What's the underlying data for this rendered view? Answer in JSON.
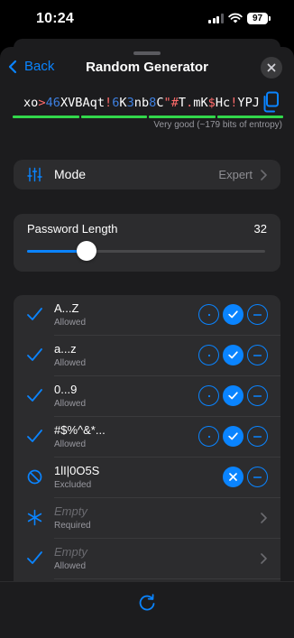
{
  "status": {
    "time": "10:24",
    "battery": "97"
  },
  "nav": {
    "back_label": "Back",
    "title": "Random Generator"
  },
  "password": {
    "parts": [
      {
        "t": "xo",
        "k": "l"
      },
      {
        "t": ">",
        "k": "s"
      },
      {
        "t": "46",
        "k": "d"
      },
      {
        "t": "XVBAqt",
        "k": "l"
      },
      {
        "t": "!",
        "k": "s"
      },
      {
        "t": "6",
        "k": "d"
      },
      {
        "t": "K",
        "k": "l"
      },
      {
        "t": "3",
        "k": "d"
      },
      {
        "t": "nb",
        "k": "l"
      },
      {
        "t": "8",
        "k": "d"
      },
      {
        "t": "C",
        "k": "l"
      },
      {
        "t": "\"#",
        "k": "s"
      },
      {
        "t": "T",
        "k": "l"
      },
      {
        "t": ".",
        "k": "s"
      },
      {
        "t": "mK",
        "k": "l"
      },
      {
        "t": "$",
        "k": "s"
      },
      {
        "t": "Hc",
        "k": "l"
      },
      {
        "t": "!",
        "k": "s"
      },
      {
        "t": "YPJ",
        "k": "l"
      }
    ],
    "strength_text": "Very good (~179 bits of entropy)",
    "strength_color": "#32d74b",
    "digit_color": "#3d7fe0",
    "symbol_color": "#ff6b6b"
  },
  "mode": {
    "label": "Mode",
    "value": "Expert"
  },
  "length": {
    "label": "Password Length",
    "value": "32",
    "fraction": 0.25
  },
  "rules": [
    {
      "name": "A...Z",
      "status": "Allowed",
      "icon": "checkmark-icon",
      "controls": "tri",
      "state": "check"
    },
    {
      "name": "a...z",
      "status": "Allowed",
      "icon": "checkmark-icon",
      "controls": "tri",
      "state": "check"
    },
    {
      "name": "0...9",
      "status": "Allowed",
      "icon": "checkmark-icon",
      "controls": "tri",
      "state": "check"
    },
    {
      "name": "#$%^&*...",
      "status": "Allowed",
      "icon": "checkmark-icon",
      "controls": "tri",
      "state": "check"
    },
    {
      "name": "1lI|0O5S",
      "status": "Excluded",
      "icon": "prohibited-icon",
      "controls": "pair",
      "state": "exclude"
    },
    {
      "name": "Empty",
      "status": "Required",
      "icon": "asterisk-icon",
      "controls": "chevron",
      "empty": true
    },
    {
      "name": "Empty",
      "status": "Allowed",
      "icon": "checkmark-icon",
      "controls": "chevron",
      "empty": true
    }
  ],
  "accent_color": "#0a84ff"
}
